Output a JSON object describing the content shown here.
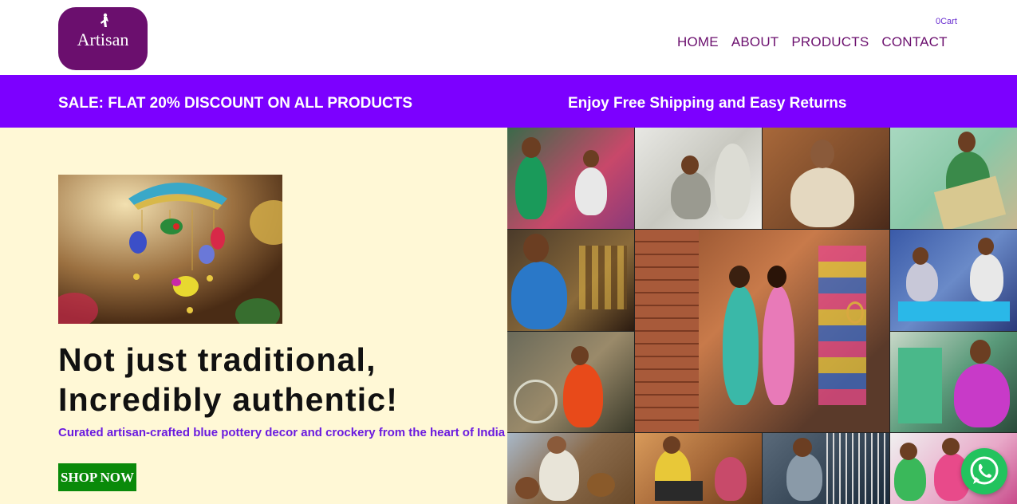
{
  "header": {
    "logo_text": "Artisan",
    "cart_label": "0Cart",
    "nav": [
      "HOME",
      "ABOUT",
      "PRODUCTS",
      "CONTACT"
    ]
  },
  "promo": {
    "left": "SALE: FLAT 20% DISCOUNT ON ALL PRODUCTS",
    "right": "Enjoy Free Shipping and Easy Returns"
  },
  "hero": {
    "headline_line1": "Not just traditional,",
    "headline_line2": "Incredibly authentic!",
    "subline": "Curated artisan-crafted blue pottery decor and crockery from the heart of India",
    "button": "SHOP NOW"
  },
  "colors": {
    "brand": "#6b0f6e",
    "promo_bar": "#7c00ff",
    "hero_bg": "#fff8d6",
    "button": "#0a8a0a",
    "whatsapp": "#22c35e"
  },
  "icons": {
    "whatsapp": "whatsapp-icon",
    "logo_figure": "artisan-figure-icon"
  }
}
